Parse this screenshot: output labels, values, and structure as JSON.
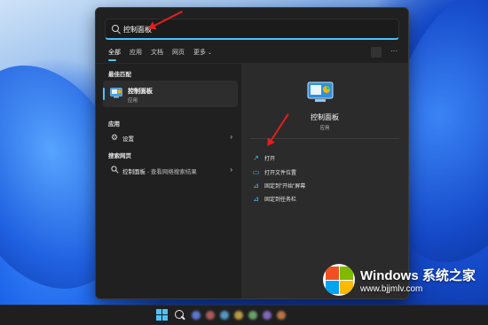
{
  "search": {
    "query": "控制面板"
  },
  "tabs": [
    {
      "label": "全部",
      "active": true
    },
    {
      "label": "应用",
      "active": false
    },
    {
      "label": "文档",
      "active": false
    },
    {
      "label": "网页",
      "active": false
    },
    {
      "label": "更多",
      "active": false
    }
  ],
  "left": {
    "best_match_title": "最佳匹配",
    "best_match": {
      "name": "控制面板",
      "type": "应用"
    },
    "apps_title": "应用",
    "apps": [
      {
        "label": "设置",
        "icon": "gear-icon"
      }
    ],
    "web_title": "搜索网页",
    "web": [
      {
        "query": "控制面板",
        "suffix": " - 查看网络搜索结果",
        "icon": "search-icon"
      }
    ]
  },
  "detail": {
    "name": "控制面板",
    "type": "应用",
    "actions": [
      {
        "label": "打开",
        "icon": "open-icon"
      },
      {
        "label": "打开文件位置",
        "icon": "folder-icon"
      },
      {
        "label": "固定到\"开始\"屏幕",
        "icon": "pin-icon"
      },
      {
        "label": "固定到任务栏",
        "icon": "pin-icon"
      }
    ]
  },
  "watermark": {
    "title": "Windows 系统之家",
    "url": "www.bjjmlv.com"
  },
  "colors": {
    "accent": "#4cc2ff",
    "annotation": "#e02020",
    "panel": "#202020"
  }
}
